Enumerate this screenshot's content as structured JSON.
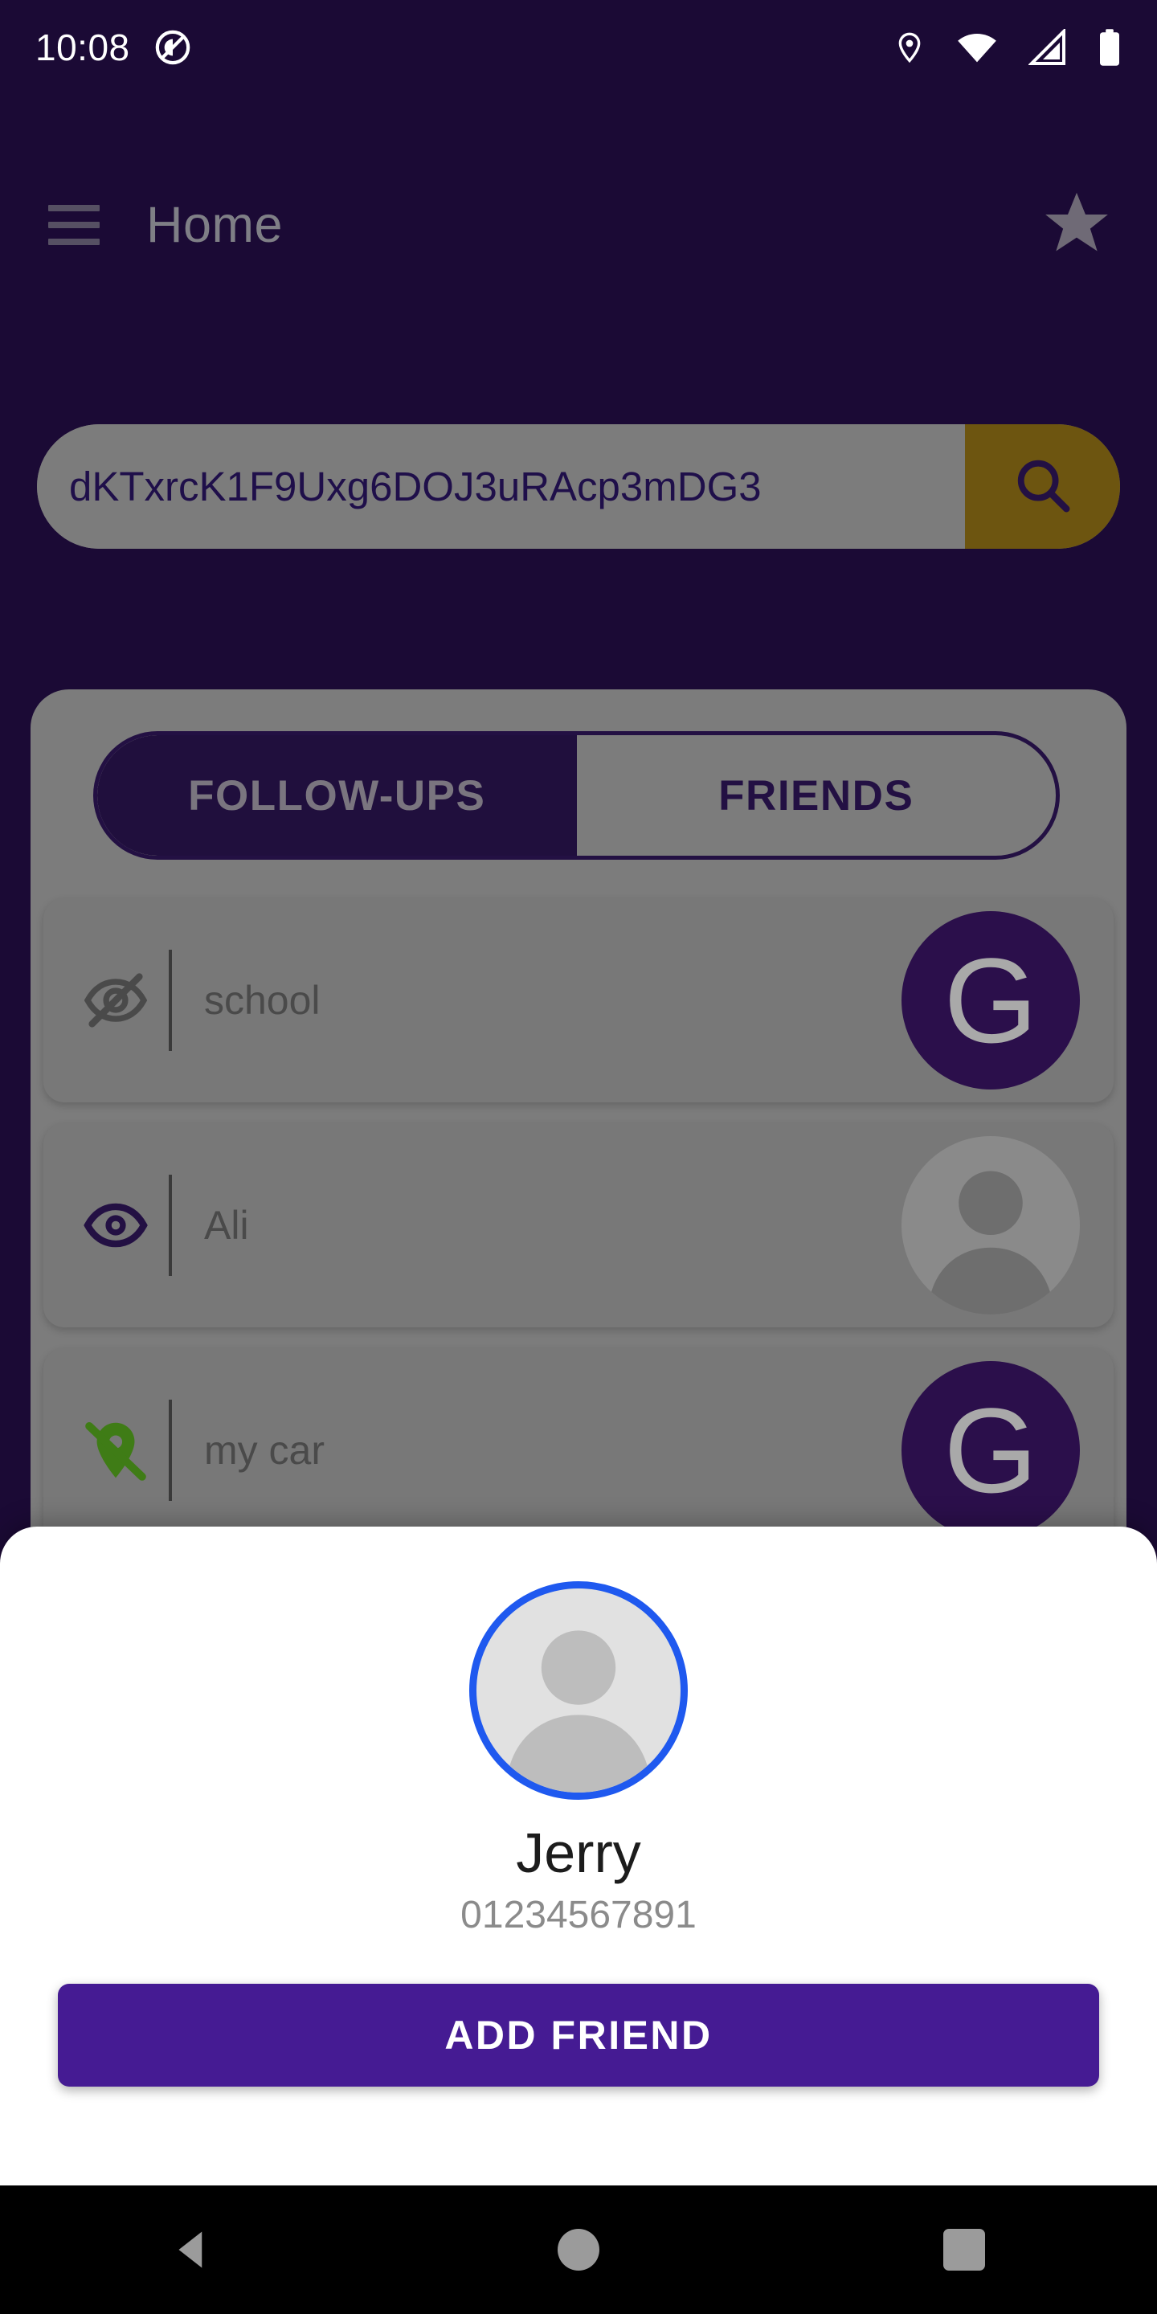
{
  "status_bar": {
    "time": "10:08",
    "icons": [
      "do-not-disturb-icon",
      "location-pin-icon",
      "wifi-icon",
      "cellular-signal-icon",
      "battery-icon"
    ]
  },
  "app_bar": {
    "menu_icon": "hamburger-menu-icon",
    "title": "Home",
    "action_icon": "star-icon"
  },
  "search": {
    "value": "dKTxrcK1F9Uxg6DOJ3uRAcp3mDG3",
    "placeholder": "Search",
    "button_icon": "search-icon",
    "button_color": "#6d5510"
  },
  "tabs": [
    {
      "label": "FOLLOW-UPS",
      "active": true
    },
    {
      "label": "FRIENDS",
      "active": false
    }
  ],
  "list": [
    {
      "label": "school",
      "icon": "eye-off-icon",
      "icon_color": "#4a4a4a",
      "avatar_type": "letter",
      "avatar_letter": "G"
    },
    {
      "label": "Ali",
      "icon": "eye-icon",
      "icon_color": "#231043",
      "avatar_type": "person",
      "avatar_letter": ""
    },
    {
      "label": "my car",
      "icon": "location-off-icon",
      "icon_color": "#3f7c16",
      "avatar_type": "letter",
      "avatar_letter": "G"
    }
  ],
  "bottom_sheet": {
    "avatar_icon": "person-placeholder-avatar",
    "avatar_ring_color": "#1f59ef",
    "name": "Jerry",
    "phone": "01234567891",
    "primary_button_label": "ADD FRIEND",
    "primary_button_color": "#451b93"
  },
  "nav_bar": {
    "back_label": "Back",
    "home_label": "Home",
    "recents_label": "Recents"
  },
  "colors": {
    "app_background": "#1b0a35",
    "scrim_surface": "#7c7c7c",
    "brand_purple": "#2b0f4b",
    "accent_gold": "#6d5510",
    "accent_blue": "#1f59ef",
    "accent_green": "#3f7c16"
  }
}
